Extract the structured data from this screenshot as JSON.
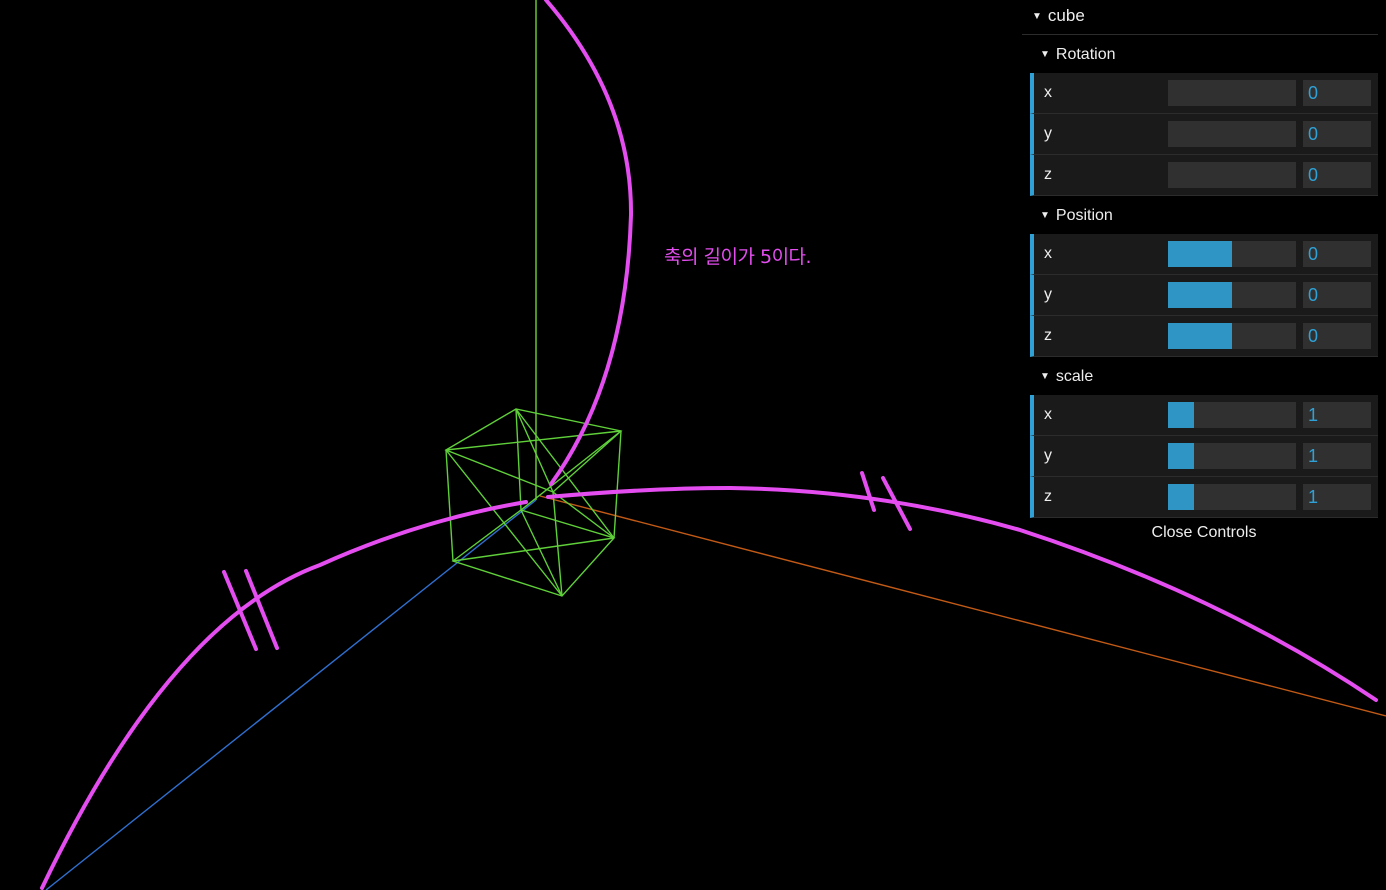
{
  "annotation": "축의 길이가 5이다.",
  "colors": {
    "magenta": "#e44ef0",
    "cube": "#5fd03a",
    "accent": "#2fa1d6"
  },
  "gui": {
    "title": "cube",
    "folders": [
      {
        "title": "Rotation",
        "rows": [
          {
            "label": "x",
            "value": "0",
            "fill": 0.0
          },
          {
            "label": "y",
            "value": "0",
            "fill": 0.0
          },
          {
            "label": "z",
            "value": "0",
            "fill": 0.0
          }
        ]
      },
      {
        "title": "Position",
        "rows": [
          {
            "label": "x",
            "value": "0",
            "fill": 0.5
          },
          {
            "label": "y",
            "value": "0",
            "fill": 0.5
          },
          {
            "label": "z",
            "value": "0",
            "fill": 0.5
          }
        ]
      },
      {
        "title": "scale",
        "rows": [
          {
            "label": "x",
            "value": "1",
            "fill": 0.2
          },
          {
            "label": "y",
            "value": "1",
            "fill": 0.2
          },
          {
            "label": "z",
            "value": "1",
            "fill": 0.2
          }
        ]
      }
    ],
    "close_label": "Close Controls"
  }
}
